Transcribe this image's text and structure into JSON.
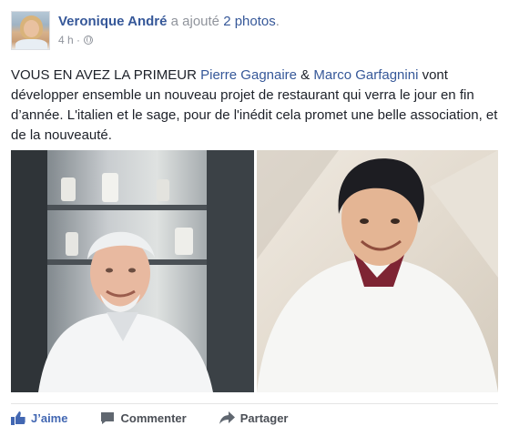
{
  "header": {
    "author": "Veronique André",
    "action_prefix": "a ajouté",
    "action_photos": "2 photos",
    "action_suffix": ".",
    "time": "4 h ·"
  },
  "message": {
    "part1": "VOUS EN AVEZ LA PRIMEUR ",
    "mention1": "Pierre Gagnaire",
    "part2": " & ",
    "mention2": "Marco Garfagnini",
    "part3": " vont développer ensemble un nouveau projet de restaurant qui verra le jour en fin d’année. L'italien et le sage, pour de l'inédit cela promet une belle association, et de la nouveauté."
  },
  "actions": {
    "like": "J’aime",
    "comment": "Commenter",
    "share": "Partager"
  },
  "colors": {
    "link": "#365899",
    "muted": "#90949c",
    "like": "#4267b2"
  }
}
